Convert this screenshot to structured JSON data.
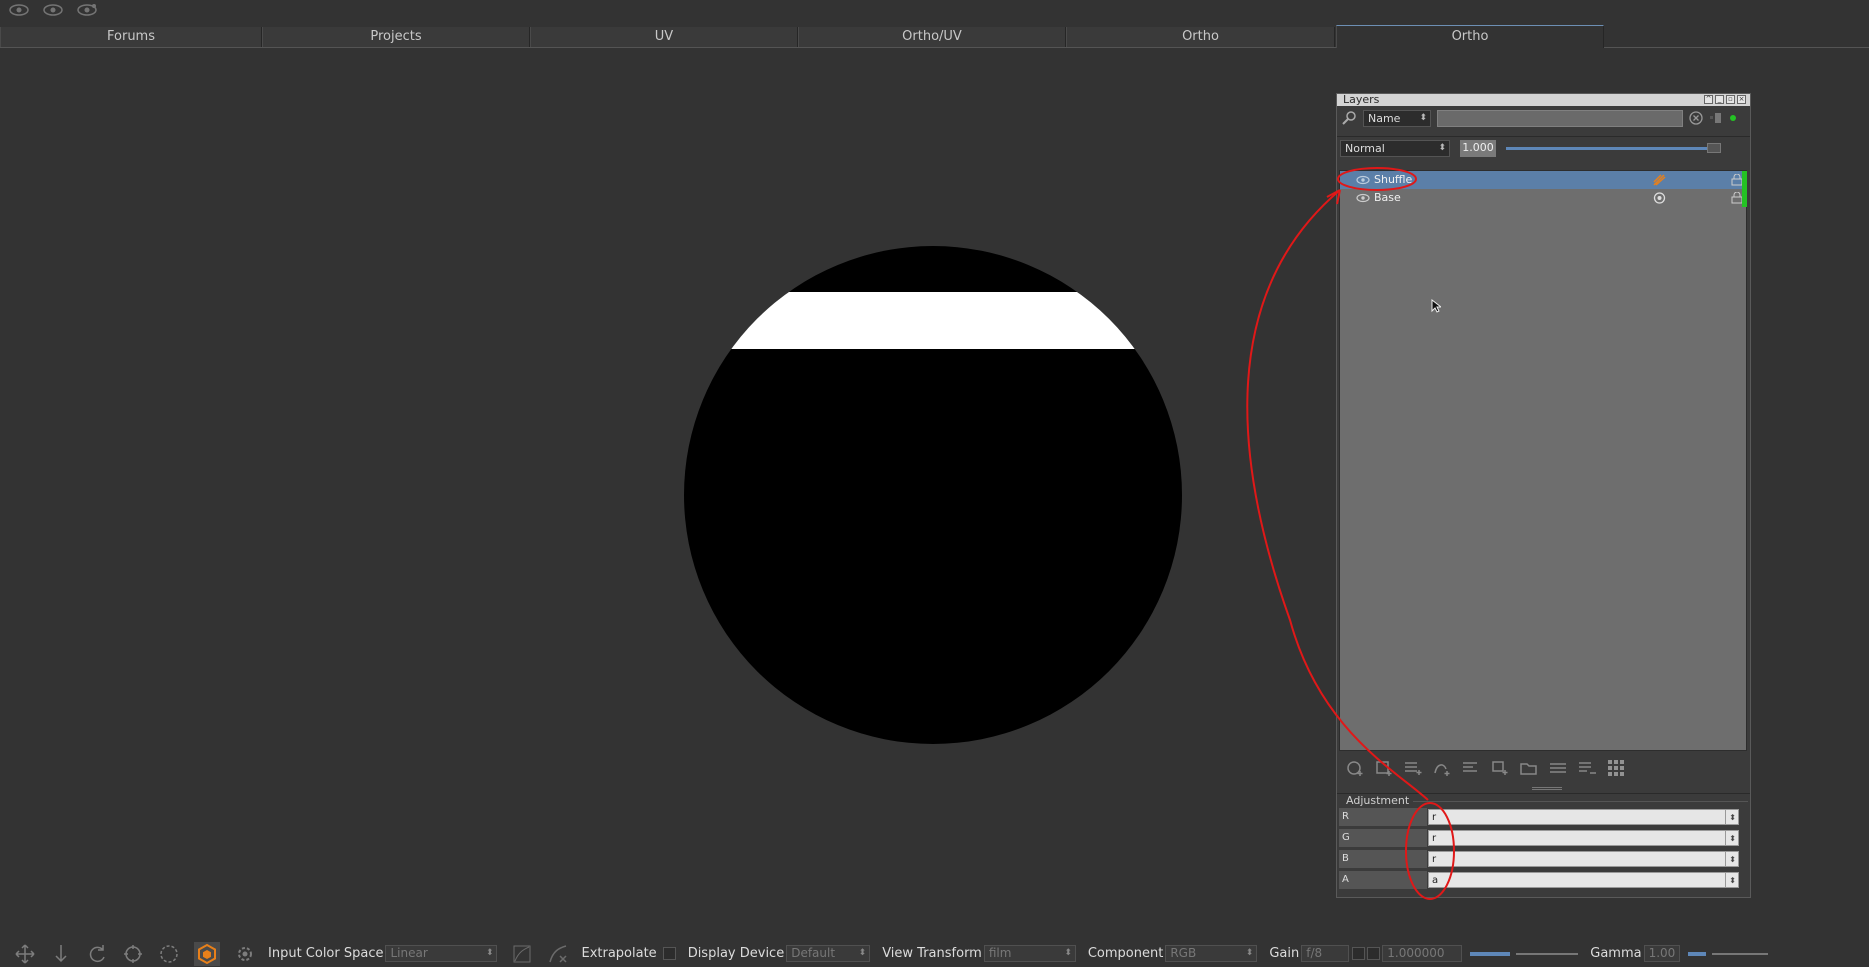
{
  "tabs": [
    {
      "label": "Forums"
    },
    {
      "label": "Projects"
    },
    {
      "label": "UV"
    },
    {
      "label": "Ortho/UV"
    },
    {
      "label": "Ortho"
    },
    {
      "label": "Ortho",
      "active": true
    }
  ],
  "layers_panel": {
    "title": "Layers",
    "filter_mode": "Name",
    "search_value": "",
    "blend_mode": "Normal",
    "opacity": "1.000",
    "layers": [
      {
        "name": "Shuffle",
        "selected": true,
        "type_icon": "paint-layer-icon"
      },
      {
        "name": "Base",
        "selected": false,
        "type_icon": "fill-layer-icon"
      }
    ],
    "adjustment": {
      "header": "Adjustment",
      "channels": [
        {
          "label": "R",
          "value": "r"
        },
        {
          "label": "G",
          "value": "r"
        },
        {
          "label": "B",
          "value": "r"
        },
        {
          "label": "A",
          "value": "a"
        }
      ]
    }
  },
  "statusbar": {
    "input_color_space_label": "Input Color Space",
    "input_color_space_value": "Linear",
    "extrapolate_label": "Extrapolate",
    "display_device_label": "Display Device",
    "display_device_value": "Default",
    "view_transform_label": "View Transform",
    "view_transform_value": "film",
    "component_label": "Component",
    "component_value": "RGB",
    "gain_label": "Gain",
    "gain_fstop": "f/8",
    "gain_value": "1.000000",
    "gamma_label": "Gamma",
    "gamma_value": "1.00"
  },
  "colors": {
    "selection_blue": "#5b7fa8",
    "annotation_red": "#e01818",
    "accent_orange": "#e8801a",
    "active_green": "#24c224"
  }
}
